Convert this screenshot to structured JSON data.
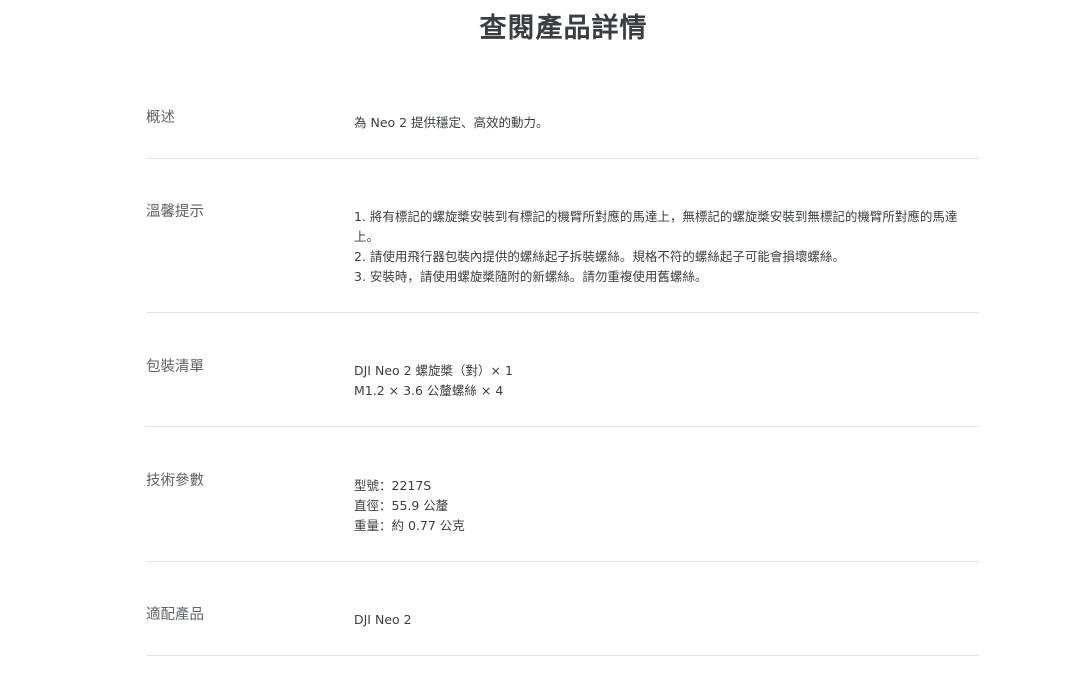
{
  "page": {
    "title": "查閱產品詳情"
  },
  "specs": {
    "overview": {
      "label": "概述",
      "lines": [
        "為 Neo 2 提供穩定、高效的動力。"
      ]
    },
    "tips": {
      "label": "溫馨提示",
      "lines": [
        "1. 將有標記的螺旋槳安裝到有標記的機臂所對應的馬達上，無標記的螺旋槳安裝到無標記的機臂所對應的馬達上。",
        "2. 請使用飛行器包裝內提供的螺絲起子拆裝螺絲。規格不符的螺絲起子可能會損壞螺絲。",
        "3. 安裝時，請使用螺旋槳隨附的新螺絲。請勿重複使用舊螺絲。"
      ]
    },
    "package": {
      "label": "包裝清單",
      "lines": [
        "DJI Neo 2 螺旋槳（對）× 1",
        "M1.2 × 3.6 公釐螺絲 × 4"
      ]
    },
    "tech": {
      "label": "技術參數",
      "lines": [
        "型號：2217S",
        "直徑：55.9 公釐",
        "重量：約 0.77 公克"
      ]
    },
    "compatible": {
      "label": "適配產品",
      "lines": [
        "DJI Neo 2"
      ]
    }
  }
}
